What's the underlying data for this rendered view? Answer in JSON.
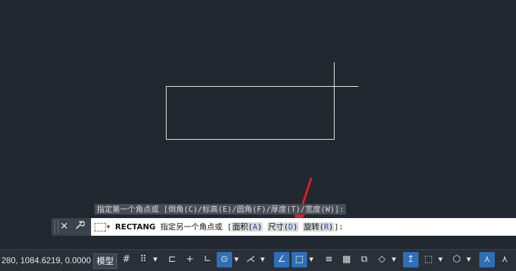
{
  "command_history": "指定第一个角点或 [倒角(C)/标高(E)/圆角(F)/厚度(T)/宽度(W)]:",
  "command_line": {
    "command_name": "RECTANG",
    "prompt": "指定另一个角点或 [",
    "options": [
      {
        "label": "面积",
        "key": "A"
      },
      {
        "label": "尺寸",
        "key": "D"
      },
      {
        "label": "旋转",
        "key": "R"
      }
    ],
    "suffix": "]:"
  },
  "status_bar": {
    "coordinates": "280, 1084.6219, 0.0000",
    "model_tab": "模型"
  },
  "colors": {
    "canvas_bg": "#212830",
    "accent": "#2e6fb7",
    "annotation_arrow": "#e02020"
  },
  "icons": {
    "close": "close-icon",
    "customize": "wrench-icon",
    "grid": "grid-icon",
    "snap": "snap-mode-icon",
    "ortho": "ortho-icon",
    "polar": "polar-tracking-icon",
    "osnap": "object-snap-icon",
    "lineweight": "lineweight-icon",
    "transparency": "transparency-icon"
  }
}
